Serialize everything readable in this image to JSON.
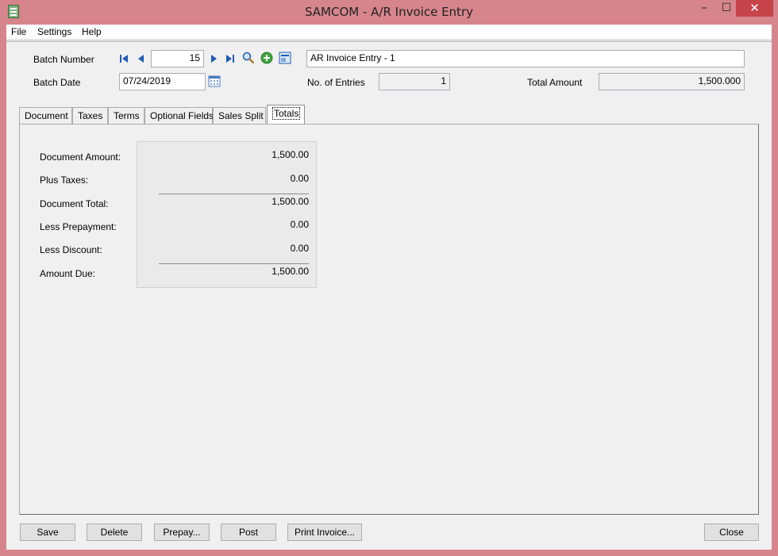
{
  "window": {
    "title": "SAMCOM - A/R Invoice Entry",
    "min_glyph": "–",
    "max_glyph": "☐",
    "close_glyph": "✕"
  },
  "menu": {
    "file": "File",
    "settings": "Settings",
    "help": "Help"
  },
  "header": {
    "batch_number_label": "Batch Number",
    "batch_number": "15",
    "batch_description": "AR Invoice Entry - 1",
    "batch_date_label": "Batch Date",
    "batch_date": "07/24/2019",
    "entries_label": "No. of Entries",
    "entries": "1",
    "total_label": "Total Amount",
    "total": "1,500.000"
  },
  "tabs": [
    "Document",
    "Taxes",
    "Terms",
    "Optional Fields",
    "Sales Split",
    "Totals"
  ],
  "active_tab": "Totals",
  "totals": {
    "document_amount_label": "Document Amount:",
    "document_amount": "1,500.00",
    "plus_taxes_label": "Plus Taxes:",
    "plus_taxes": "0.00",
    "document_total_label": "Document Total:",
    "document_total": "1,500.00",
    "less_prepayment_label": "Less Prepayment:",
    "less_prepayment": "0.00",
    "less_discount_label": "Less Discount:",
    "less_discount": "0.00",
    "amount_due_label": "Amount Due:",
    "amount_due": "1,500.00"
  },
  "buttons": {
    "save": "Save",
    "delete": "Delete",
    "prepay": "Prepay...",
    "post": "Post",
    "print": "Print Invoice...",
    "close": "Close"
  },
  "colors": {
    "frame": "#d6858c",
    "close_button": "#c7444a",
    "nav_blue": "#1e5bb5",
    "zoom_green": "#3fa33f"
  }
}
